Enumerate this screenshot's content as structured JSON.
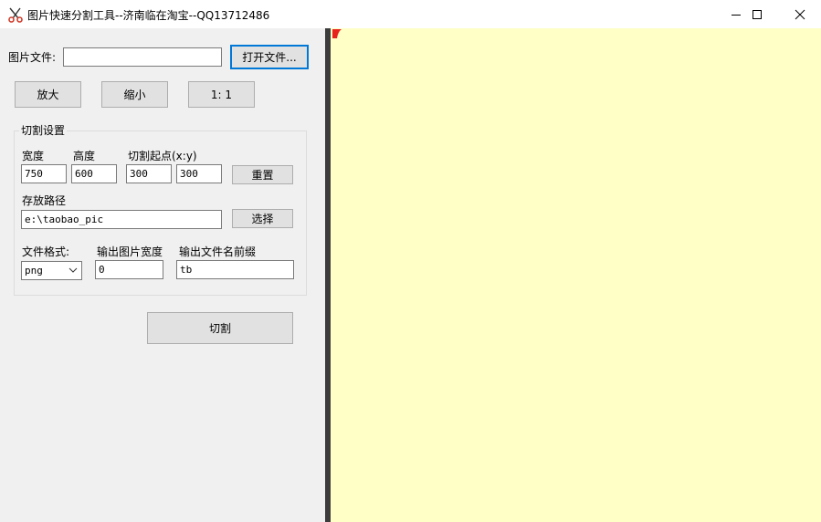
{
  "window": {
    "title": "图片快速分割工具--济南临在淘宝--QQ13712486",
    "app_icon": "scissors-icon",
    "controls": [
      "minimize-icon",
      "maximize-icon",
      "close-icon"
    ]
  },
  "file_row": {
    "label": "图片文件:",
    "path_value": "",
    "open_button": "打开文件..."
  },
  "zoom": {
    "zoom_in": "放大",
    "zoom_out": "缩小",
    "actual_size": "1: 1"
  },
  "cut_settings": {
    "group_title": "切割设置",
    "width_label": "宽度",
    "height_label": "高度",
    "origin_label": "切割起点(x:y)",
    "width_value": "750",
    "height_value": "600",
    "origin_x": "300",
    "origin_y": "300",
    "reset_button": "重置",
    "save_path_label": "存放路径",
    "save_path_value": "e:\\taobao_pic",
    "choose_button": "选择",
    "format_label": "文件格式:",
    "format_selected": "png",
    "output_width_label": "输出图片宽度",
    "output_width_value": "0",
    "prefix_label": "输出文件名前缀",
    "prefix_value": "tb"
  },
  "actions": {
    "cut_button": "切割"
  },
  "canvas": {
    "background": "#ffffc6",
    "marker_color": "#e8231e"
  }
}
